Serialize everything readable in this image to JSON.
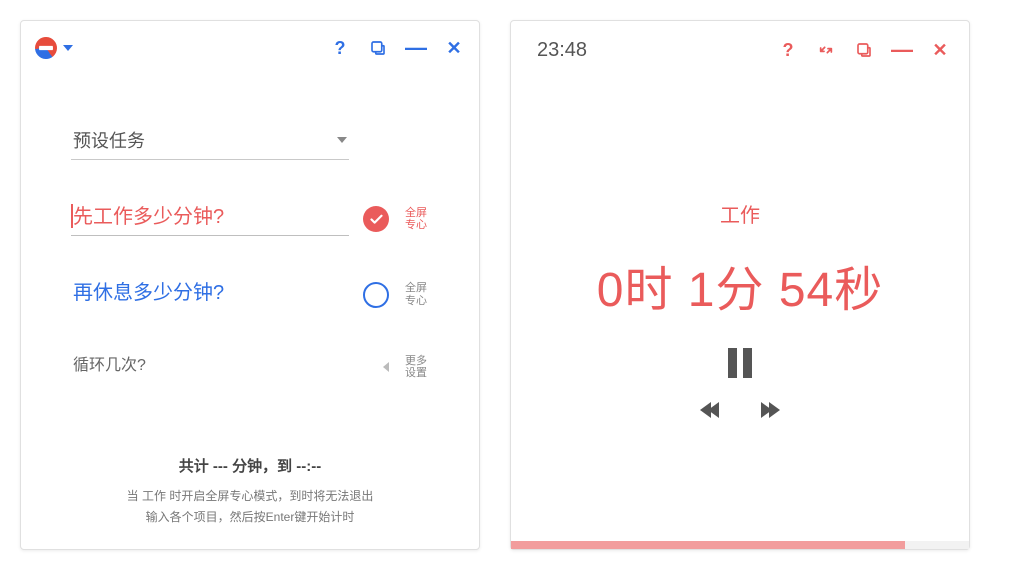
{
  "colors": {
    "blue": "#2f6fe4",
    "red": "#ea5b5b",
    "grey": "#555"
  },
  "left": {
    "preset": {
      "label": "预设任务"
    },
    "work": {
      "placeholder": "先工作多少分钟?",
      "value": "",
      "focus_label": "全屏\n专心",
      "checked": true
    },
    "rest": {
      "placeholder": "再休息多少分钟?",
      "value": "",
      "focus_label": "全屏\n专心",
      "checked": false
    },
    "loop": {
      "placeholder": "循环几次?",
      "value": "",
      "more_label": "更多\n设置"
    },
    "footer": {
      "total": "共计 --- 分钟，到 --:--",
      "hint1": "当 工作 时开启全屏专心模式，到时将无法退出",
      "hint2": "输入各个项目，然后按Enter键开始计时"
    }
  },
  "right": {
    "clock": "23:48",
    "mode": "工作",
    "timer": "0时 1分 54秒",
    "progress_pct": 86
  }
}
